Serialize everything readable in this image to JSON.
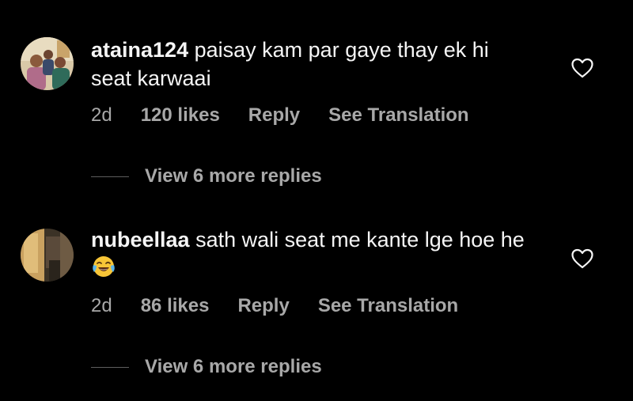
{
  "comments": [
    {
      "username": "ataina124",
      "text": "paisay kam par gaye thay ek hi seat karwaai",
      "time": "2d",
      "likes": "120 likes",
      "reply": "Reply",
      "translate": "See Translation",
      "view_replies": "View 6 more replies",
      "avatar_icon": "family-photo-avatar"
    },
    {
      "username": "nubeellaa",
      "text": "sath wali seat me kante lge hoe he",
      "emoji": "face-with-tears-of-joy-icon",
      "time": "2d",
      "likes": "86 likes",
      "reply": "Reply",
      "translate": "See Translation",
      "view_replies": "View 6 more replies",
      "avatar_icon": "room-photo-avatar"
    }
  ],
  "colors": {
    "background": "#000000",
    "primary_text": "#f5f5f5",
    "secondary_text": "#a8a8a8"
  }
}
